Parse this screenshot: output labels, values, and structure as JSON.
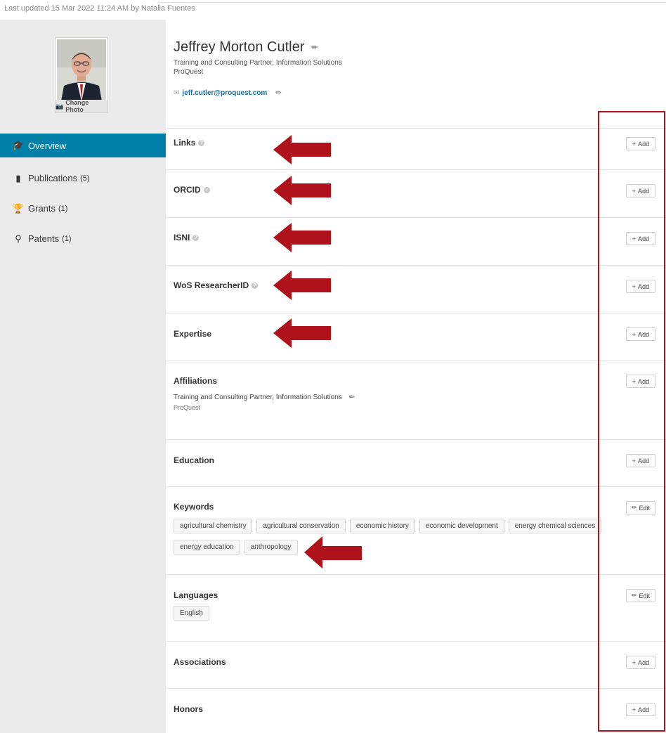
{
  "meta": {
    "last_updated": "Last updated 15 Mar 2022 11:24 AM by Natalia Fuentes"
  },
  "sidebar": {
    "change_photo_label": "Change Photo",
    "nav": [
      {
        "label": "Overview",
        "count": "",
        "icon": "graduation-cap-icon",
        "active": true
      },
      {
        "label": "Publications",
        "count": "(5)",
        "icon": "book-icon",
        "active": false
      },
      {
        "label": "Grants",
        "count": "(1)",
        "icon": "trophy-icon",
        "active": false
      },
      {
        "label": "Patents",
        "count": "(1)",
        "icon": "lightbulb-icon",
        "active": false
      }
    ]
  },
  "profile": {
    "name": "Jeffrey Morton Cutler",
    "title": "Training and Consulting Partner, Information Solutions",
    "organization": "ProQuest",
    "email": "jeff.cutler@proquest.com"
  },
  "sections": {
    "links": {
      "title": "Links",
      "button": "Add"
    },
    "orcid": {
      "title": "ORCID",
      "button": "Add"
    },
    "isni": {
      "title": "ISNI",
      "button": "Add"
    },
    "wos": {
      "title": "WoS ResearcherID",
      "button": "Add"
    },
    "expertise": {
      "title": "Expertise",
      "button": "Add"
    },
    "affiliations": {
      "title": "Affiliations",
      "button": "Add",
      "entry_title": "Training and Consulting Partner, Information Solutions",
      "entry_org": "ProQuest"
    },
    "education": {
      "title": "Education",
      "button": "Add"
    },
    "keywords": {
      "title": "Keywords",
      "button": "Edit",
      "tags": [
        "agricultural chemistry",
        "agricultural conservation",
        "economic history",
        "economic development",
        "energy chemical sciences",
        "energy education",
        "anthropology"
      ]
    },
    "languages": {
      "title": "Languages",
      "button": "Edit",
      "tags": [
        "English"
      ]
    },
    "associations": {
      "title": "Associations",
      "button": "Add"
    },
    "honors": {
      "title": "Honors",
      "button": "Add"
    }
  },
  "colors": {
    "accent": "#007fa8",
    "annotation_red": "#b0121b",
    "sidebar_bg": "#ebebeb",
    "email_link": "#1a6fa0"
  }
}
